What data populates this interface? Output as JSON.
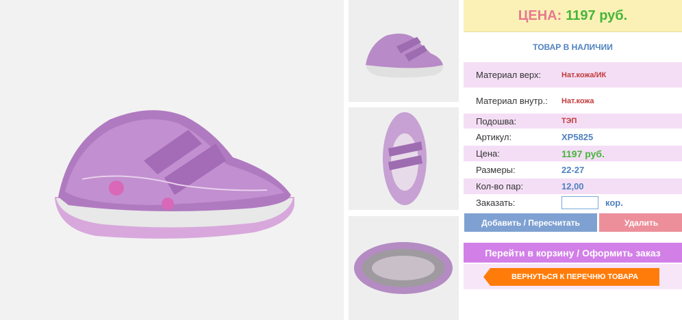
{
  "product": {
    "main_image_alt": "purple-kids-sneaker-photo",
    "thumbnails": [
      "side-view",
      "top-view",
      "sole-view"
    ]
  },
  "price_box": {
    "label": "ЦЕНА:",
    "value": "1197 руб."
  },
  "stock_status": "ТОВАР В НАЛИЧИИ",
  "details": [
    {
      "label": "Материал верх:",
      "value": "Нат.кожа/ИК"
    },
    {
      "label": "Материал внутр.:",
      "value": "Нат.кожа"
    },
    {
      "label": "Подошва:",
      "value": "ТЭП"
    },
    {
      "label": "Артикул:",
      "value": "XP5825"
    },
    {
      "label": "Цена:",
      "value": "1197 руб."
    },
    {
      "label": "Размеры:",
      "value": "22-27"
    },
    {
      "label": "Кол-во пар:",
      "value": "12,00"
    }
  ],
  "order": {
    "label": "Заказать:",
    "value": "",
    "unit": "кор."
  },
  "buttons": {
    "add": "Добавить / Пересчитать",
    "delete": "Удалить",
    "cart": "Перейти в корзину / Оформить заказ",
    "back": "ВЕРНУТЬСЯ К ПЕРЕЧНЮ ТОВАРА"
  },
  "colors": {
    "price_bg": "#fbf1b6",
    "price_label": "#e6798f",
    "price_value": "#45b53a",
    "row_highlight": "#f4def5",
    "add_button": "#7fa1d2",
    "delete_button": "#ec8f9b",
    "cart_button": "#d27fe8",
    "back_button": "#ff7c0a"
  }
}
